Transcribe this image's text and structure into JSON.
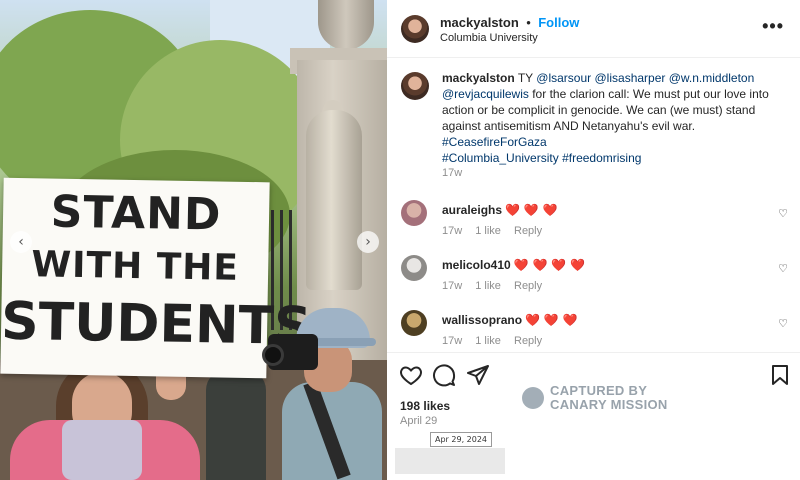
{
  "photo": {
    "sign_lines": [
      "STAND",
      "WITH THE",
      "STUDENTS"
    ],
    "prev_arrow": "‹",
    "next_arrow": "›"
  },
  "post_header": {
    "username": "mackyalston",
    "separator": "•",
    "follow_label": "Follow",
    "location": "Columbia University",
    "more_icon": "•••"
  },
  "caption": {
    "username": "mackyalston",
    "text_before": "TY ",
    "mentions": [
      "@lsarsour",
      "@lisasharper",
      "@w.n.middleton",
      "@revjacquilewis"
    ],
    "body": " for the clarion call: We must put our love into action or be complicit in genocide. We can (we must) stand against antisemitism AND Netanyahu's evil war.",
    "hashtags_line1": "#CeasefireForGaza",
    "hashtags_line2a": "#Columbia_University",
    "hashtags_line2b": "#freedomrising",
    "timestamp": "17w"
  },
  "comments": [
    {
      "username": "auraleighs",
      "hearts": "❤️ ❤️ ❤️",
      "age": "17w",
      "likes": "1 like",
      "reply": "Reply"
    },
    {
      "username": "melicolo410",
      "hearts": "❤️ ❤️ ❤️ ❤️",
      "age": "17w",
      "likes": "1 like",
      "reply": "Reply"
    },
    {
      "username": "wallissoprano",
      "hearts": "❤️ ❤️ ❤️",
      "age": "17w",
      "likes": "1 like",
      "reply": "Reply"
    }
  ],
  "actions": {
    "like_icon": "heart-outline",
    "comment_icon": "speech-bubble",
    "share_icon": "paper-plane",
    "save_icon": "bookmark",
    "likes_count": "198 likes",
    "date": "April 29",
    "date_tooltip": "Apr 29, 2024"
  },
  "watermark": {
    "line1": "CAPTURED BY",
    "line2": "CANARY MISSION"
  },
  "colors": {
    "link": "#00376b",
    "follow": "#0095f6",
    "heart": "#e0245e",
    "muted": "#8e8e8e"
  }
}
